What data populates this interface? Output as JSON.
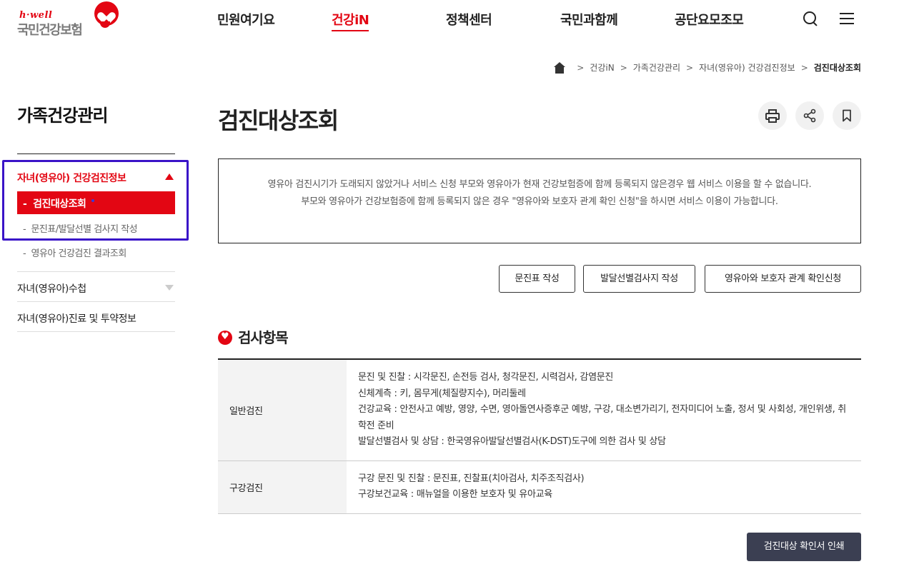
{
  "header": {
    "logo_top": "h·well",
    "logo_name": "국민건강보험",
    "nav": [
      "민원여기요",
      "건강iN",
      "정책센터",
      "국민과함께",
      "공단요모조모"
    ],
    "active_nav": "건강iN"
  },
  "breadcrumb": [
    "건강iN",
    "가족건강관리",
    "자녀(영유아) 건강검진정보",
    "검진대상조회"
  ],
  "sidebar": {
    "title": "가족건강관리",
    "menu_1": "자녀(영유아) 건강검진정보",
    "sub_active": "검진대상조회",
    "sub_2": "문진표/발달선별 검사지 작성",
    "sub_3": "영유아 건강검진 결과조회",
    "menu_2": "자녀(영유아)수첩",
    "menu_3": "자녀(영유아)진료 및 투약정보"
  },
  "main": {
    "title": "검진대상조회",
    "notice_line1": "영유아 검진시기가 도래되지 않았거나 서비스 신청 부모와 영유아가 현재 건강보험증에 함께 등록되지 않은경우 웹 서비스 이용을 할 수 없습니다.",
    "notice_line2": "부모와 영유아가 건강보험증에 함께 등록되지 않은 경우 \"영유아와 보호자 관계 확인 신청\"을 하시면 서비스 이용이 가능합니다.",
    "buttons": [
      "문진표 작성",
      "발달선별검사지 작성",
      "영유아와 보호자 관계 확인신청"
    ],
    "section_title": "검사항목",
    "rows": [
      {
        "label": "일반검진",
        "lines": [
          "문진 및 진찰 : 시각문진, 손전등 검사, 청각문진, 시력검사, 감염문진",
          "신체계측 : 키, 몸무게(체질량지수), 머리둘레",
          "건강교육 : 안전사고 예방, 영양, 수면, 영아돌연사증후군 예방, 구강, 대소변가리기, 전자미디어 노출, 정서 및 사회성, 개인위생, 취학전 준비",
          "발달선별검사 및 상담 : 한국영유아발달선별검사(K-DST)도구에 의한 검사 및 상담"
        ]
      },
      {
        "label": "구강검진",
        "lines": [
          "구강 문진 및 진찰 : 문진표, 진찰표(치아검사, 치주조직검사)",
          "구강보건교육 : 매뉴얼을 이용한 보호자 및 유아교육"
        ]
      }
    ],
    "print_button": "검진대상 확인서 인쇄"
  },
  "colors": {
    "brand_red": "#e30613",
    "highlight": "#3a13c8",
    "dark_button": "#3b3f52"
  },
  "icons": [
    "search-icon",
    "menu-icon",
    "home-icon",
    "print-icon",
    "share-icon",
    "bookmark-icon",
    "heart-icon"
  ]
}
